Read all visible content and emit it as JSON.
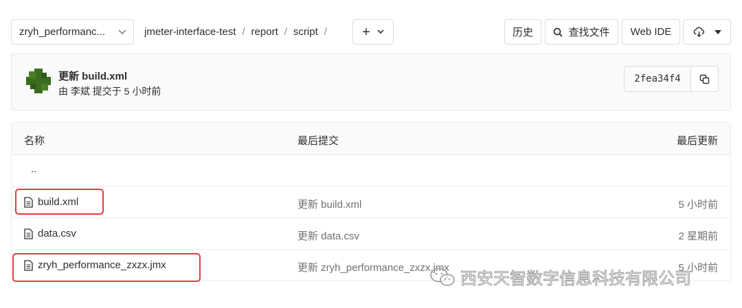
{
  "toolbar": {
    "branch": "zryh_performanc...",
    "breadcrumb": [
      "jmeter-interface-test",
      "report",
      "script"
    ],
    "add_label": "+",
    "history": "历史",
    "find_file": "查找文件",
    "web_ide": "Web IDE"
  },
  "commit": {
    "title": "更新 build.xml",
    "meta": "由 李斌 提交于 5 小时前",
    "sha": "2fea34f4",
    "avatar_color": "#3a6b1e"
  },
  "table": {
    "headers": {
      "name": "名称",
      "last_commit": "最后提交",
      "last_update": "最后更新"
    },
    "updir": "..",
    "rows": [
      {
        "name": "build.xml",
        "message": "更新 build.xml",
        "time": "5 小时前"
      },
      {
        "name": "data.csv",
        "message": "更新 data.csv",
        "time": "2 星期前"
      },
      {
        "name": "zryh_performance_zxzx.jmx",
        "message": "更新 zryh_performance_zxzx.jmx",
        "time": "5 小时前"
      }
    ]
  },
  "watermark": "西安天智数字信息科技有限公司",
  "highlight_color": "#e8383d"
}
